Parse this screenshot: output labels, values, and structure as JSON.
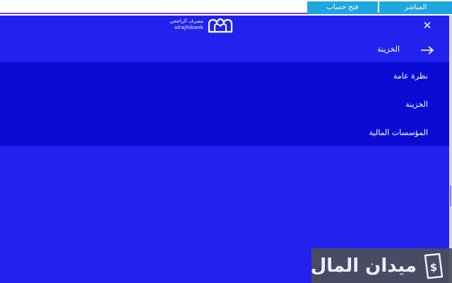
{
  "topbar": {
    "live_label": "المباشر",
    "open_account_label": "فتح حساب"
  },
  "header": {
    "logo": {
      "arabic": "مصرف الراجحي",
      "english": "alrajhibank"
    },
    "close_icon": "close-icon"
  },
  "drawer": {
    "back_label": "الخزينة",
    "back_icon": "arrow-right-icon",
    "items": [
      {
        "label": "نظرة عامة"
      },
      {
        "label": "الخزينة"
      },
      {
        "label": "المؤسسات المالية"
      }
    ]
  },
  "watermark": {
    "text": "ميدان المال",
    "icon": "money-bag-icon"
  },
  "colors": {
    "drawer_bg": "#2222ee",
    "submenu_bg": "#0b0bd4",
    "topbar_btn": "#1fa6e0",
    "topbar_border": "#7b3ff0"
  }
}
